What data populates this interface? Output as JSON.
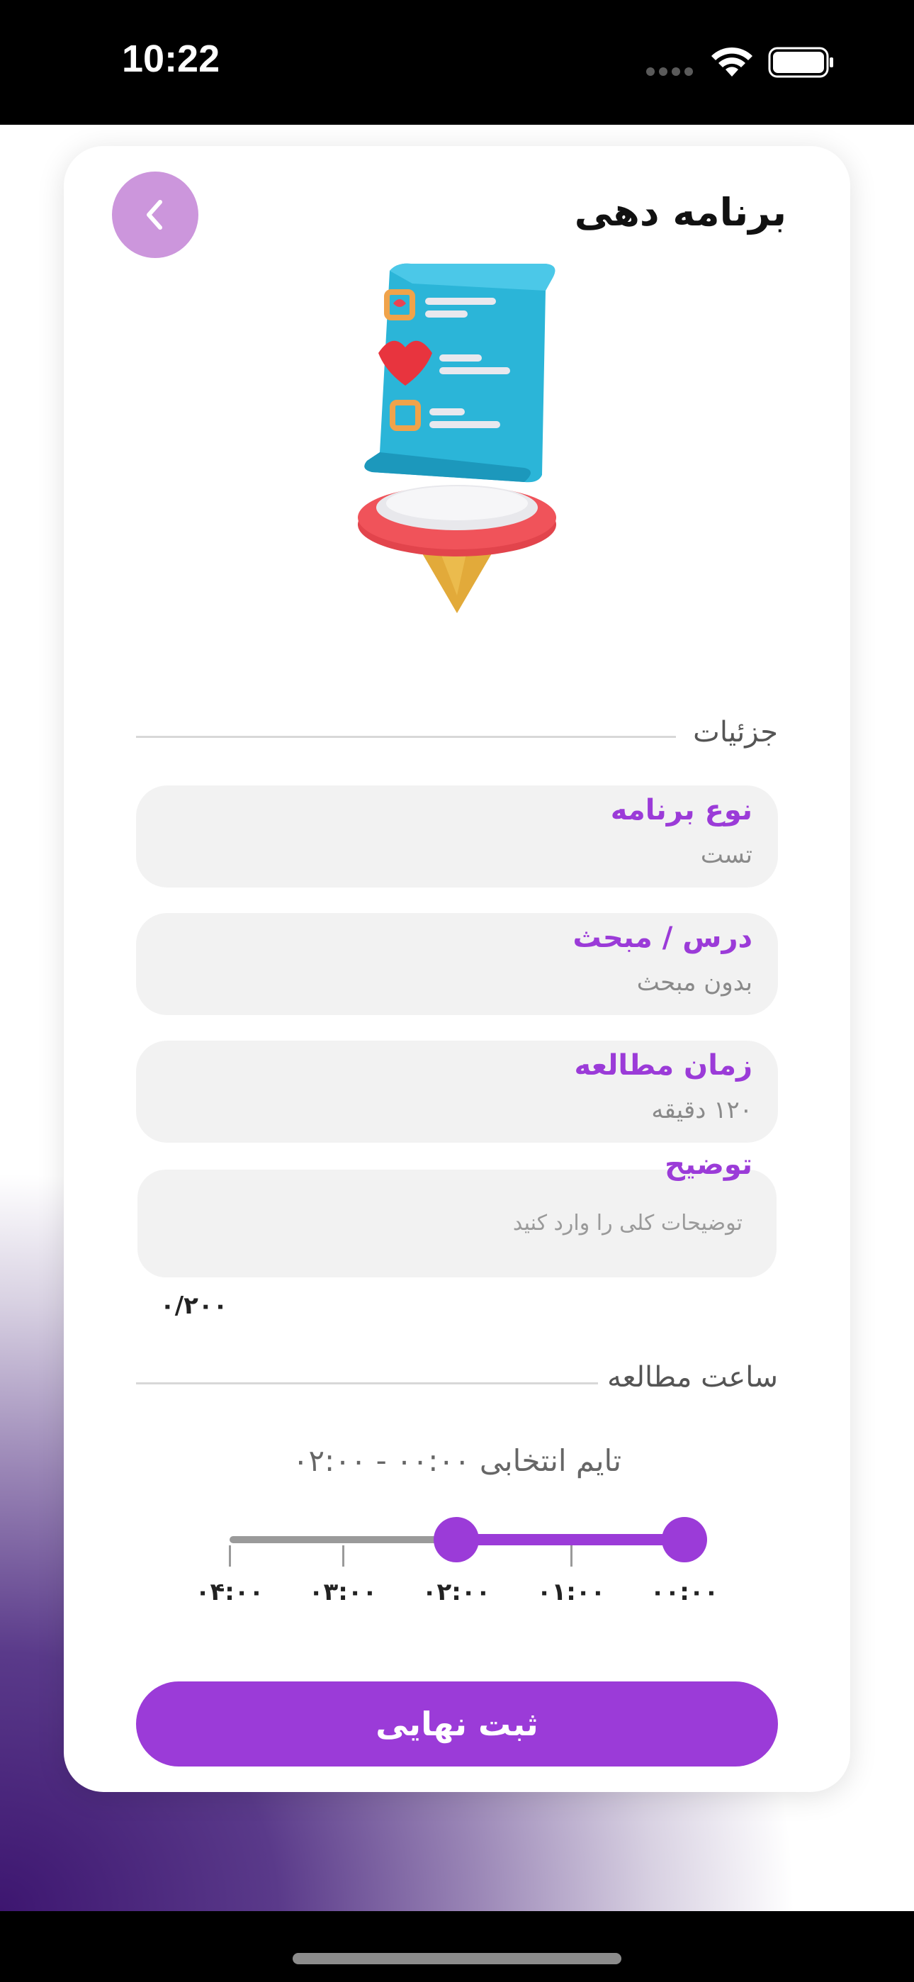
{
  "status_bar": {
    "time": "10:22"
  },
  "header": {
    "title": "برنامه دهی"
  },
  "details": {
    "heading": "جزئیات",
    "fields": [
      {
        "label": "نوع برنامه",
        "value": "تست"
      },
      {
        "label": "درس / مبحث",
        "value": "بدون مبحث"
      },
      {
        "label": "زمان مطالعه",
        "value": "۱۲۰ دقیقه"
      }
    ],
    "description": {
      "label": "توضیح",
      "placeholder": "توضیحات کلی را وارد کنید",
      "counter": "۰/۲۰۰"
    }
  },
  "study_time": {
    "heading": "ساعت مطالعه",
    "summary": "تایم انتخابی ۰۰:۰۰ - ۰۲:۰۰",
    "ticks": [
      "۰۴:۰۰",
      "۰۳:۰۰",
      "۰۲:۰۰",
      "۰۱:۰۰",
      "۰۰:۰۰"
    ],
    "range_start": "۰۰:۰۰",
    "range_end": "۰۲:۰۰"
  },
  "submit": {
    "label": "ثبت نهایی"
  },
  "colors": {
    "accent": "#9b3bd8",
    "back_button": "#cc96dc"
  }
}
